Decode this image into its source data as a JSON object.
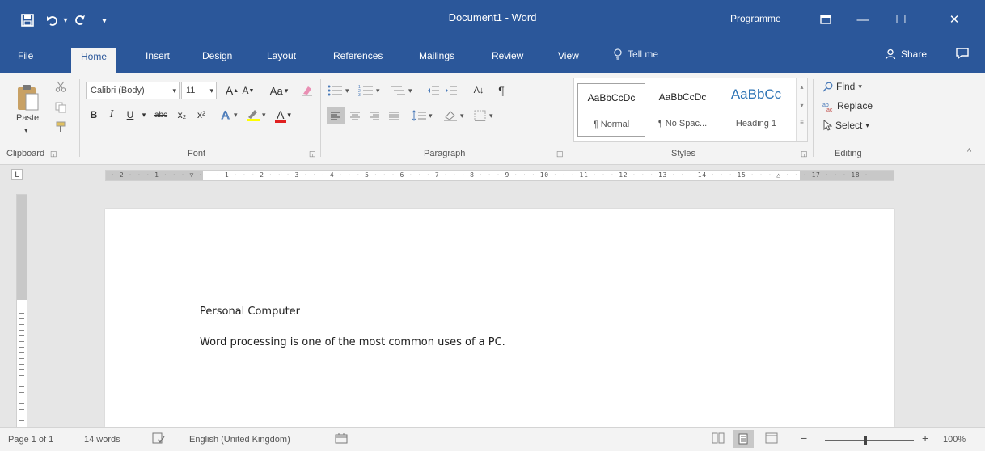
{
  "window": {
    "title": "Document1 - Word",
    "account": "Programme",
    "ribbon_display_icon": "ribbon-display-options-icon",
    "minimize": "—",
    "maximize": "☐",
    "close": "✕"
  },
  "quick_access": {
    "save_icon": "save-icon",
    "undo_icon": "undo-icon",
    "redo_icon": "redo-icon",
    "customize_icon": "customize-qat-icon"
  },
  "tabs": [
    "File",
    "Home",
    "Insert",
    "Design",
    "Layout",
    "References",
    "Mailings",
    "Review",
    "View"
  ],
  "tell_me": "Tell me",
  "share": "Share",
  "ribbon": {
    "clipboard": {
      "paste": "Paste",
      "label": "Clipboard"
    },
    "font": {
      "name": "Calibri (Body)",
      "size": "11",
      "grow": "A",
      "shrink": "A",
      "change_case": "Aa",
      "bold": "B",
      "italic": "I",
      "underline": "U",
      "strike": "abc",
      "subscript": "x₂",
      "superscript": "x²",
      "font_color": "A",
      "label": "Font"
    },
    "paragraph": {
      "sort": "A↓",
      "pilcrow": "¶",
      "label": "Paragraph"
    },
    "styles": {
      "items": [
        {
          "preview": "AaBbCcDc",
          "name": "¶ Normal"
        },
        {
          "preview": "AaBbCcDc",
          "name": "¶ No Spac..."
        },
        {
          "preview": "AaBbCc",
          "name": "Heading 1"
        }
      ],
      "label": "Styles"
    },
    "editing": {
      "find": "Find",
      "replace": "Replace",
      "select": "Select",
      "label": "Editing"
    }
  },
  "ruler": {
    "scale": "· 2 · · · 1 · · · ▽ · · · 1 · · · 2 · · · 3 · · · 4 · · · 5 · · · 6 · · · 7 · · · 8 · · · 9 · · · 10 · · · 11 · · · 12 · · · 13 · · · 14 · · · 15 · · · △ · · · 17 · · · 18 ·",
    "tab_selector": "L"
  },
  "document": {
    "lines": [
      "Personal Computer",
      "Word processing is one of the most common uses of a PC."
    ]
  },
  "status": {
    "page": "Page 1 of 1",
    "words": "14 words",
    "language": "English (United Kingdom)",
    "zoom": "100%",
    "zoom_minus": "−",
    "zoom_plus": "+"
  },
  "colors": {
    "accent": "#2b579a",
    "ribbon_bg": "#f3f3f3",
    "canvas_bg": "#e6e6e6"
  }
}
